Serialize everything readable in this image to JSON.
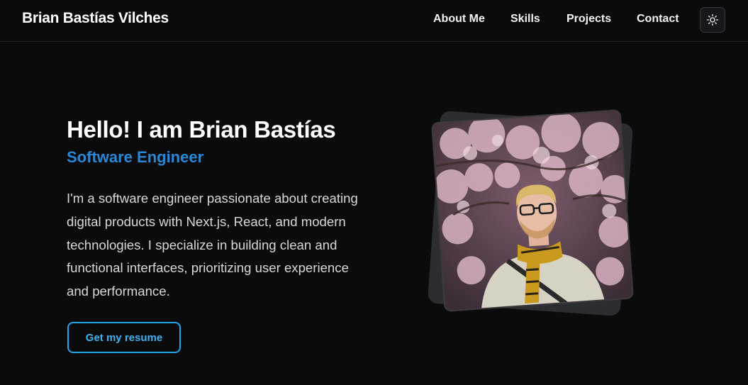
{
  "header": {
    "brand": "Brian Bastías Vilches",
    "nav": [
      {
        "label": "About Me"
      },
      {
        "label": "Skills"
      },
      {
        "label": "Projects"
      },
      {
        "label": "Contact"
      }
    ],
    "theme_toggle_icon": "sun-icon"
  },
  "hero": {
    "title": "Hello! I am Brian Bastías",
    "subtitle": "Software Engineer",
    "description": "I'm a software engineer passionate about creating digital products with Next.js, React, and modern technologies. I specialize in building clean and functional interfaces, prioritizing user experience and performance.",
    "resume_button": "Get my resume"
  },
  "colors": {
    "background": "#0b0b0c",
    "accent": "#2a86d6",
    "button_border": "#22a6ee"
  }
}
